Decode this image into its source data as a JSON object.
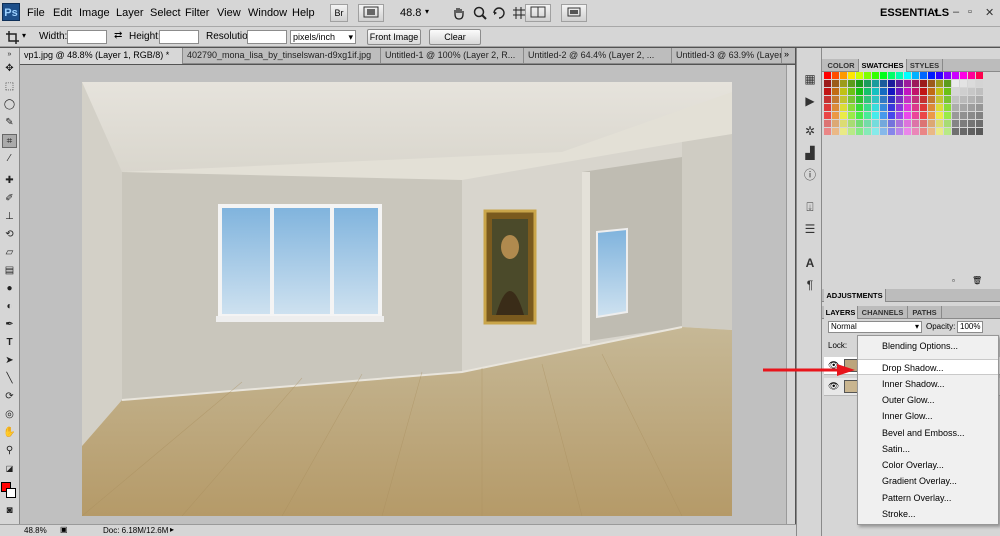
{
  "app": {
    "logo": "Ps",
    "workspace": "ESSENTIALS"
  },
  "menus": [
    "File",
    "Edit",
    "Image",
    "Layer",
    "Select",
    "Filter",
    "View",
    "Window",
    "Help"
  ],
  "menubar": {
    "bridge_label": "Br",
    "zoom": "48.8"
  },
  "options": {
    "width_label": "Width:",
    "height_label": "Height:",
    "resolution_label": "Resolution:",
    "units": "pixels/inch",
    "front_image": "Front Image",
    "clear": "Clear"
  },
  "tabs": [
    "vp1.jpg @ 48.8% (Layer 1, RGB/8) *",
    "402790_mona_lisa_by_tinselswan-d9xg1if.jpg",
    "Untitled-1 @ 100% (Layer 2, R...",
    "Untitled-2 @ 64.4% (Layer 2, ...",
    "Untitled-3 @ 63.9% (Layer 2, ..."
  ],
  "status": {
    "zoom": "48.8%",
    "doc": "Doc: 6.18M/12.6M"
  },
  "panels": {
    "color_tabs": [
      "COLOR",
      "SWATCHES",
      "STYLES"
    ],
    "adjustments": "ADJUSTMENTS",
    "layers_tabs": [
      "LAYERS",
      "CHANNELS",
      "PATHS"
    ],
    "blend_mode": "Normal",
    "opacity_label": "Opacity:",
    "opacity_value": "100%",
    "lock_label": "Lock:"
  },
  "context_menu": {
    "items": [
      "Blending Options...",
      "Drop Shadow...",
      "Inner Shadow...",
      "Outer Glow...",
      "Inner Glow...",
      "Bevel and Emboss...",
      "Satin...",
      "Color Overlay...",
      "Gradient Overlay...",
      "Pattern Overlay...",
      "Stroke..."
    ],
    "highlighted_index": 1
  },
  "colors": {
    "foreground": "#ff0000",
    "background": "#ffffff",
    "annotation_arrow": "#e8141b"
  }
}
